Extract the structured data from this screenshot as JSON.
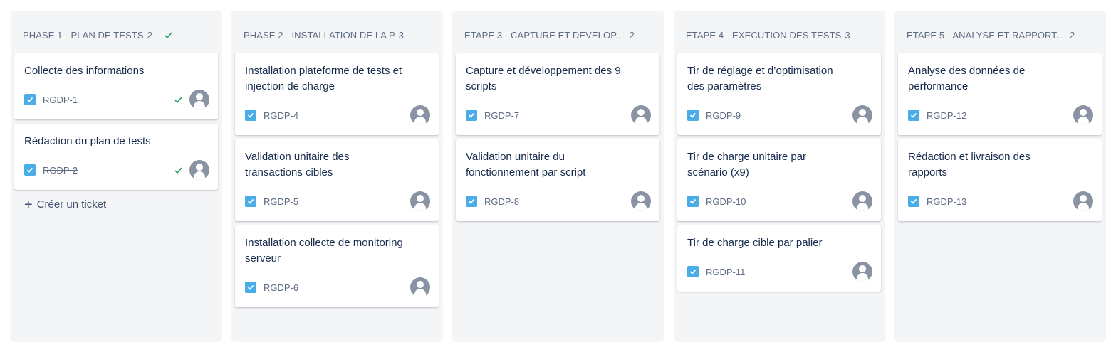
{
  "columns": [
    {
      "title": "PHASE 1 - PLAN DE TESTS",
      "count": "2",
      "done": true,
      "cards": [
        {
          "title": "Collecte des informations",
          "key": "RGDP-1",
          "resolved": true
        },
        {
          "title": "Rédaction du plan de tests",
          "key": "RGDP-2",
          "resolved": true
        }
      ],
      "create_label": "Créer un ticket"
    },
    {
      "title": "PHASE 2 - INSTALLATION DE LA P",
      "count": "3",
      "done": false,
      "cards": [
        {
          "title": "Installation plateforme de tests et injection de charge",
          "key": "RGDP-4",
          "resolved": false
        },
        {
          "title": "Validation unitaire des transactions cibles",
          "key": "RGDP-5",
          "resolved": false
        },
        {
          "title": "Installation collecte de monitoring serveur",
          "key": "RGDP-6",
          "resolved": false
        }
      ]
    },
    {
      "title": "ETAPE 3 - CAPTURE ET DEVELOP...",
      "count": "2",
      "done": false,
      "cards": [
        {
          "title": "Capture et développement des 9 scripts",
          "key": "RGDP-7",
          "resolved": false
        },
        {
          "title": "Validation unitaire du fonctionnement par script",
          "key": "RGDP-8",
          "resolved": false
        }
      ]
    },
    {
      "title": "ETAPE 4 - EXECUTION DES TESTS",
      "count": "3",
      "done": false,
      "cards": [
        {
          "title": "Tir de réglage et d’optimisation des paramètres",
          "key": "RGDP-9",
          "resolved": false
        },
        {
          "title": "Tir de charge unitaire par scénario (x9)",
          "key": "RGDP-10",
          "resolved": false
        },
        {
          "title": "Tir de charge cible par palier",
          "key": "RGDP-11",
          "resolved": false
        }
      ]
    },
    {
      "title": "ETAPE 5 - ANALYSE ET RAPPORT...",
      "count": "2",
      "done": false,
      "cards": [
        {
          "title": "Analyse des données de performance",
          "key": "RGDP-12",
          "resolved": false
        },
        {
          "title": "Rédaction et livraison des rapports",
          "key": "RGDP-13",
          "resolved": false
        }
      ]
    }
  ],
  "colors": {
    "column_bg": "#f4f5f7",
    "checkbox": "#4bade8",
    "done_green": "#2e9f6a",
    "avatar": "#8993a4"
  }
}
